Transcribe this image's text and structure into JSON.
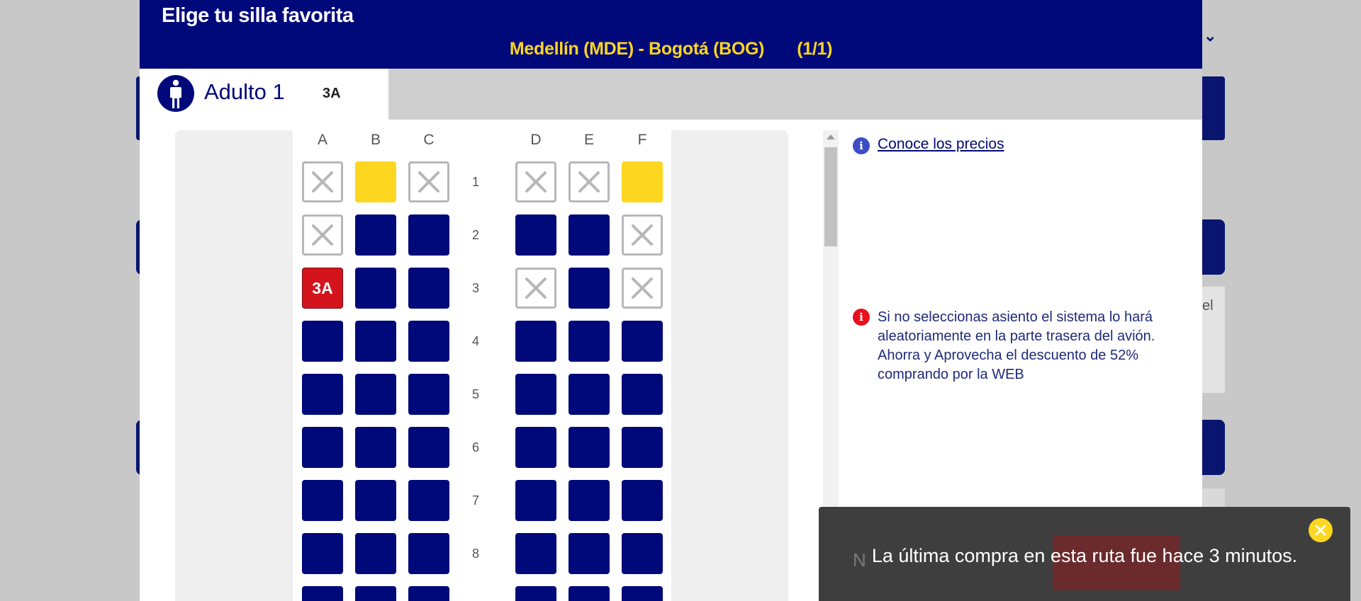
{
  "header": {
    "title": "Elige tu silla favorita",
    "route": "Medellín (MDE) - Bogotá (BOG)",
    "segment_counter": "(1/1)"
  },
  "passenger_tab": {
    "name": "Adulto 1",
    "seat": "3A",
    "icon": "person-icon"
  },
  "seatmap": {
    "columns": [
      "A",
      "B",
      "C",
      "D",
      "E",
      "F"
    ],
    "rows": [
      {
        "number": "1",
        "seats": [
          "occupied",
          "premium",
          "occupied",
          "occupied",
          "occupied",
          "premium"
        ]
      },
      {
        "number": "2",
        "seats": [
          "occupied",
          "available",
          "available",
          "available",
          "available",
          "occupied"
        ]
      },
      {
        "number": "3",
        "seats": [
          "selected",
          "available",
          "available",
          "occupied",
          "available",
          "occupied"
        ]
      },
      {
        "number": "4",
        "seats": [
          "available",
          "available",
          "available",
          "available",
          "available",
          "available"
        ]
      },
      {
        "number": "5",
        "seats": [
          "available",
          "available",
          "available",
          "available",
          "available",
          "available"
        ]
      },
      {
        "number": "6",
        "seats": [
          "available",
          "available",
          "available",
          "available",
          "available",
          "available"
        ]
      },
      {
        "number": "7",
        "seats": [
          "available",
          "available",
          "available",
          "available",
          "available",
          "available"
        ]
      },
      {
        "number": "8",
        "seats": [
          "available",
          "available",
          "available",
          "available",
          "available",
          "available"
        ]
      }
    ],
    "selected_seat_label": "3A",
    "colors": {
      "available": "#00097a",
      "premium": "#fdd61f",
      "selected": "#d4141c",
      "occupied": "#b7b7b7"
    }
  },
  "info_panel": {
    "prices_link": "Conoce los precios",
    "warning": "Si no seleccionas asiento el sistema lo hará aleatoriamente en la parte trasera del avión. Ahorra y Aprovecha el descuento de 52% comprando por la WEB"
  },
  "toast": {
    "message": "La última compra en esta ruta fue hace 3 minutos."
  },
  "background": {
    "partial_text": "el",
    "partial_letter": "N"
  }
}
